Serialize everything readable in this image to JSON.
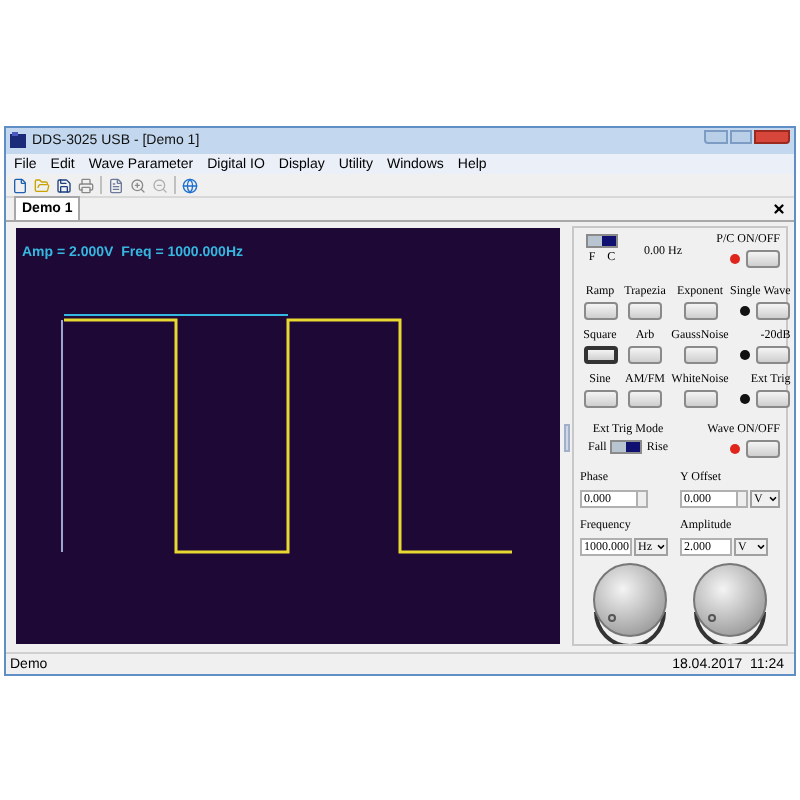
{
  "window": {
    "title": "DDS-3025 USB - [Demo 1]"
  },
  "menu": [
    "File",
    "Edit",
    "Wave Parameter",
    "Digital IO",
    "Display",
    "Utility",
    "Windows",
    "Help"
  ],
  "tabs": [
    {
      "label": "Demo 1",
      "selected": true
    }
  ],
  "scope": {
    "readout": "Amp = 2.000V  Freq = 1000.000Hz"
  },
  "panel": {
    "fc_switch": {
      "options": [
        {
          "label": "F",
          "selected": false
        },
        {
          "label": "C",
          "selected": true
        }
      ]
    },
    "frequency_display": "0.00 Hz",
    "pc": {
      "label": "P/C ON/OFF",
      "on": true
    },
    "waves": [
      {
        "label": "Ramp",
        "selected": false
      },
      {
        "label": "Trapezia",
        "selected": false
      },
      {
        "label": "Exponent",
        "selected": false
      },
      {
        "label": "Square",
        "selected": true
      },
      {
        "label": "Arb",
        "selected": false
      },
      {
        "label": "GaussNoise",
        "selected": false
      },
      {
        "label": "Sine",
        "selected": false
      },
      {
        "label": "AM/FM",
        "selected": false
      },
      {
        "label": "WhiteNoise",
        "selected": false
      }
    ],
    "toggles": [
      {
        "label": "Single Wave",
        "on": false
      },
      {
        "label": "-20dB",
        "on": false
      },
      {
        "label": "Ext Trig",
        "on": false
      }
    ],
    "trig_mode": {
      "label": "Ext Trig Mode",
      "options": [
        {
          "label": "Fall",
          "selected": false
        },
        {
          "label": "Rise",
          "selected": true
        }
      ]
    },
    "wave_onoff": {
      "label": "Wave ON/OFF",
      "on": true
    },
    "phase": {
      "label": "Phase",
      "value": "0.000"
    },
    "y_offset": {
      "label": "Y Offset",
      "value": "0.000",
      "unit": "V"
    },
    "frequency": {
      "label": "Frequency",
      "value": "1000.000",
      "unit": "Hz"
    },
    "amplitude": {
      "label": "Amplitude",
      "value": "2.000",
      "unit": "V"
    }
  },
  "status_bar": {
    "left": "Demo",
    "right": "18.04.2017  11:24"
  }
}
